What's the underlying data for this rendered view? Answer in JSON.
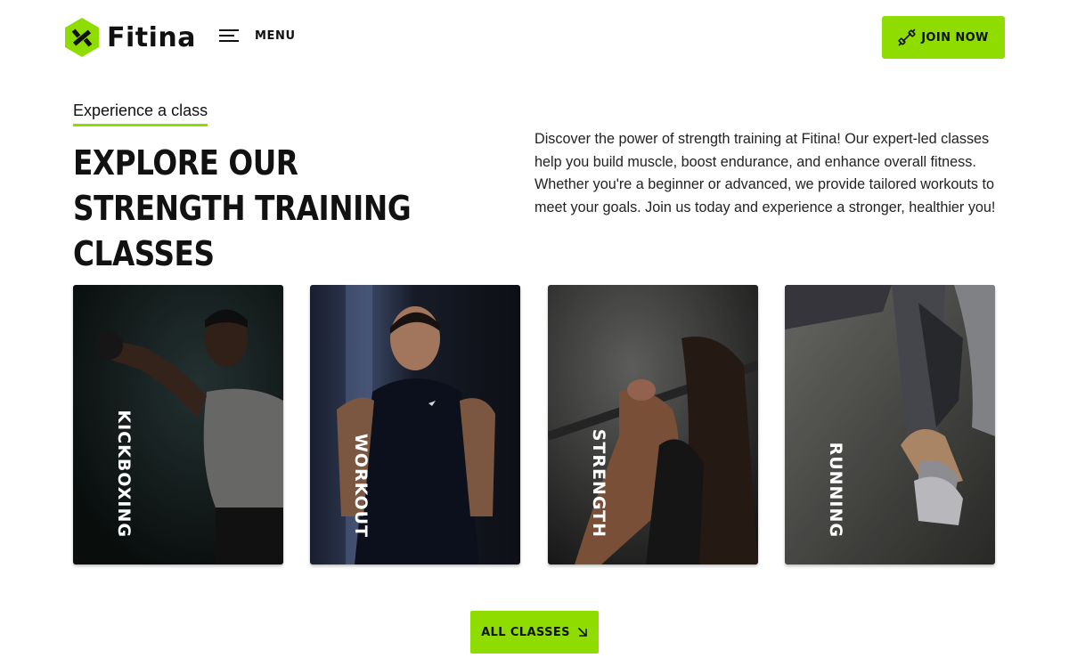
{
  "brand": {
    "name": "Fitina",
    "accent": "#8fdc00"
  },
  "header": {
    "menu_label": "MENU",
    "join_label": "JOIN NOW",
    "join_icon": "dumbbell-icon"
  },
  "intro": {
    "eyebrow": "Experience a class",
    "title": "EXPLORE OUR STRENGTH TRAINING CLASSES",
    "description": "Discover the power of strength training at Fitina! Our expert-led classes help you build muscle, boost endurance, and enhance overall fitness. Whether you're a beginner or advanced, we provide tailored workouts to meet your goals. Join us today and experience a stronger, healthier you!"
  },
  "classes": [
    {
      "label": "KICKBOXING"
    },
    {
      "label": "WORKOUT"
    },
    {
      "label": "STRENGTH"
    },
    {
      "label": "RUNNING"
    }
  ],
  "footer": {
    "all_label": "ALL CLASSES",
    "all_icon": "arrow-down-right-icon"
  }
}
